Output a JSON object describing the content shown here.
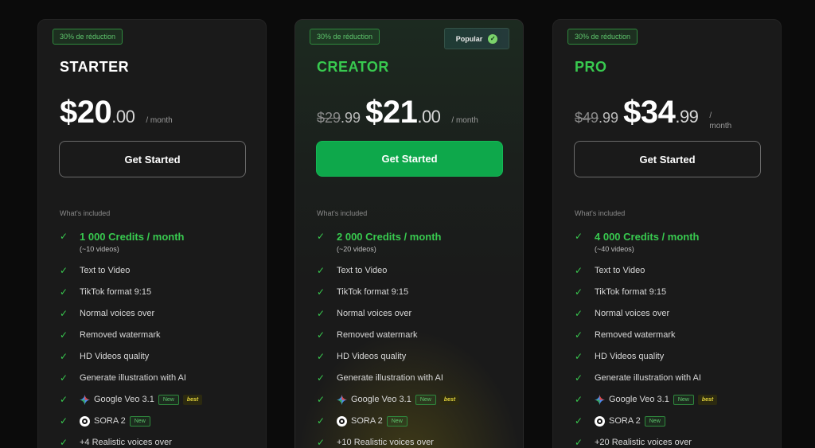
{
  "plans": [
    {
      "discount": "30% de réduction",
      "name": "STARTER",
      "old_price_main": "",
      "old_price_cents": "",
      "price_main": "$20",
      "price_cents": ".00",
      "per": "/ month",
      "cta": "Get Started",
      "included_label": "What's included",
      "credits": "1 000 Credits / month",
      "credits_sub": "(~10 videos)",
      "features": [
        "Text to Video",
        "TikTok format 9:15",
        "Normal voices over",
        "Removed watermark",
        "HD Videos quality",
        "Generate illustration with AI"
      ],
      "veo": "Google Veo 3.1",
      "sora": "SORA 2",
      "voices": "+4 Realistic voices over"
    },
    {
      "discount": "30% de réduction",
      "popular": "Popular",
      "name": "CREATOR",
      "old_price_main": "$29",
      "old_price_cents": ".99",
      "price_main": "$21",
      "price_cents": ".00",
      "per": "/ month",
      "cta": "Get Started",
      "included_label": "What's included",
      "credits": "2 000 Credits / month",
      "credits_sub": "(~20 videos)",
      "features": [
        "Text to Video",
        "TikTok format 9:15",
        "Normal voices over",
        "Removed watermark",
        "HD Videos quality",
        "Generate illustration with AI"
      ],
      "veo": "Google Veo 3.1",
      "sora": "SORA 2",
      "voices": "+10 Realistic voices over"
    },
    {
      "discount": "30% de réduction",
      "name": "PRO",
      "old_price_main": "$49",
      "old_price_cents": ".99",
      "price_main": "$34",
      "price_cents": ".99",
      "per_line1": "/",
      "per_line2": "month",
      "cta": "Get Started",
      "included_label": "What's included",
      "credits": "4 000 Credits / month",
      "credits_sub": "(~40 videos)",
      "features": [
        "Text to Video",
        "TikTok format 9:15",
        "Normal voices over",
        "Removed watermark",
        "HD Videos quality",
        "Generate illustration with AI"
      ],
      "veo": "Google Veo 3.1",
      "sora": "SORA 2",
      "voices": "+20 Realistic voices over"
    }
  ],
  "tags": {
    "new": "New",
    "best": "best"
  },
  "icons": {
    "check": "check-icon",
    "veo": "google-gemini-icon",
    "sora": "openai-icon",
    "verified": "verified-check-icon"
  },
  "colors": {
    "accent_green": "#38c94f",
    "cta_green": "#0ea84b",
    "card_bg": "#1a1a1a",
    "page_bg": "#0b0b0b",
    "best_yellow": "#e3d33a"
  }
}
